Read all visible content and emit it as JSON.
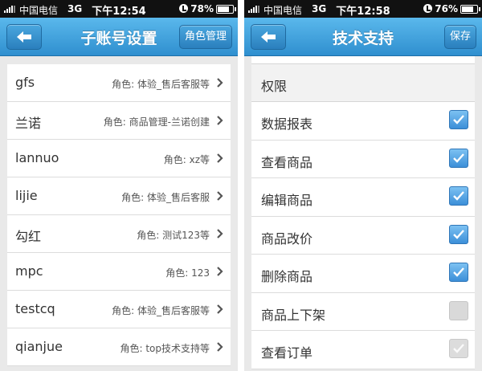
{
  "left": {
    "status": {
      "carrier": "中国电信",
      "network": "3G",
      "time": "下午12:54",
      "battery": "78%",
      "battery_level": 0.78
    },
    "nav": {
      "title": "子账号设置",
      "right_button": "角色管理"
    },
    "accounts": [
      {
        "name": "gfs",
        "role": "角色: 体验_售后客服等"
      },
      {
        "name": "兰诺",
        "role": "角色: 商品管理-兰诺创建"
      },
      {
        "name": "lannuo",
        "role": "角色: xz等"
      },
      {
        "name": "lijie",
        "role": "角色: 体验_售后客服"
      },
      {
        "name": "勾红",
        "role": "角色: 测试123等"
      },
      {
        "name": "mpc",
        "role": "角色: 123"
      },
      {
        "name": "testcq",
        "role": "角色: 体验_售后客服等"
      },
      {
        "name": "qianjue",
        "role": "角色: top技术支持等"
      }
    ]
  },
  "right": {
    "status": {
      "carrier": "中国电信",
      "network": "3G",
      "time": "下午12:58",
      "battery": "76%",
      "battery_level": 0.76
    },
    "nav": {
      "title": "技术支持",
      "right_button": "保存"
    },
    "section_header": "权限",
    "permissions": [
      {
        "label": "数据报表",
        "state": "checked"
      },
      {
        "label": "查看商品",
        "state": "checked"
      },
      {
        "label": "编辑商品",
        "state": "checked"
      },
      {
        "label": "商品改价",
        "state": "checked"
      },
      {
        "label": "删除商品",
        "state": "checked"
      },
      {
        "label": "商品上下架",
        "state": "unchecked"
      },
      {
        "label": "查看订单",
        "state": "disabled-checked"
      }
    ]
  },
  "colors": {
    "nav_top": "#5ab8ec",
    "nav_bottom": "#2f8fcf",
    "checkbox_blue": "#3c8fd8"
  },
  "icons": {
    "back": "arrow-left-icon",
    "chevron": "chevron-right-icon",
    "check": "checkmark-icon",
    "lock": "rotation-lock-icon"
  }
}
